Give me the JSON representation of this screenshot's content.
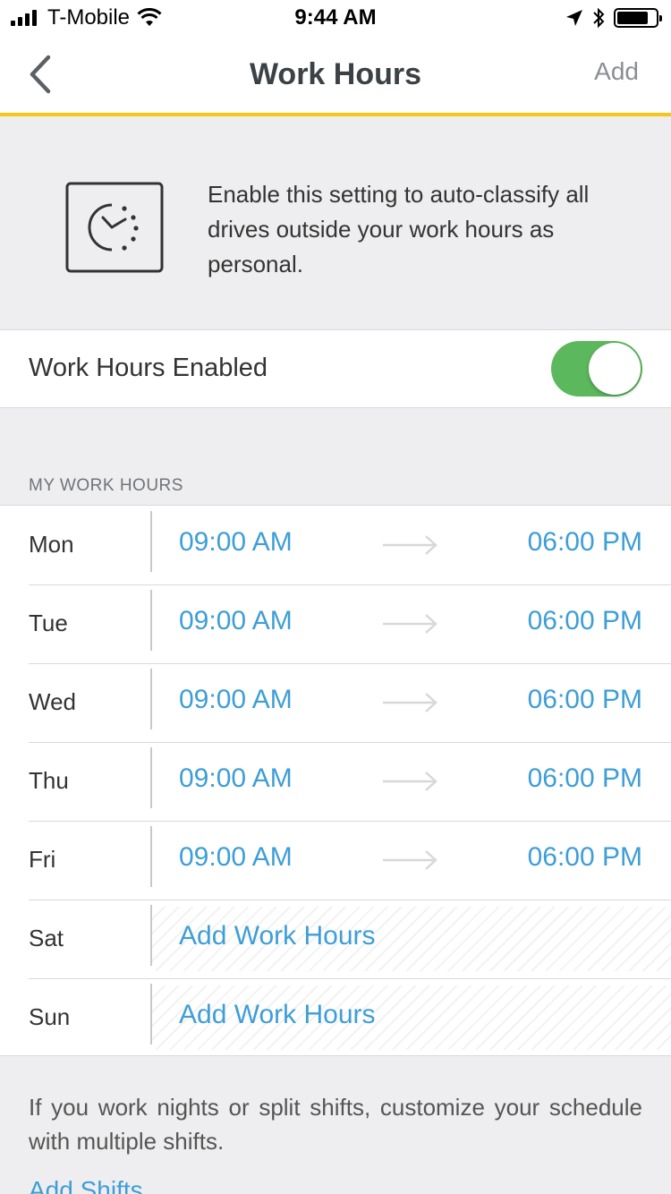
{
  "status_bar": {
    "carrier": "T-Mobile",
    "time": "9:44 AM"
  },
  "nav": {
    "title": "Work Hours",
    "add_label": "Add"
  },
  "info": {
    "text": "Enable this setting to auto-classify all drives outside your work hours as personal."
  },
  "toggle": {
    "label": "Work Hours Enabled",
    "enabled": true,
    "on_color": "#5cb85c"
  },
  "section_header": "MY WORK HOURS",
  "hours": [
    {
      "day": "Mon",
      "start": "09:00 AM",
      "end": "06:00 PM"
    },
    {
      "day": "Tue",
      "start": "09:00 AM",
      "end": "06:00 PM"
    },
    {
      "day": "Wed",
      "start": "09:00 AM",
      "end": "06:00 PM"
    },
    {
      "day": "Thu",
      "start": "09:00 AM",
      "end": "06:00 PM"
    },
    {
      "day": "Fri",
      "start": "09:00 AM",
      "end": "06:00 PM"
    },
    {
      "day": "Sat",
      "add_label": "Add Work Hours"
    },
    {
      "day": "Sun",
      "add_label": "Add Work Hours"
    }
  ],
  "footer": {
    "text": "If you work nights or split shifts, customize your schedule with multiple shifts.",
    "add_shifts_label": "Add Shifts"
  },
  "colors": {
    "accent_yellow": "#f5c518",
    "link_blue": "#3e9ed6"
  }
}
